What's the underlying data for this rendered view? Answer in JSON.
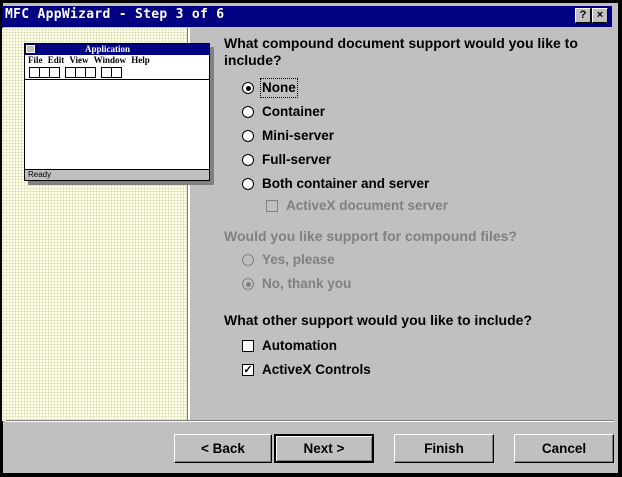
{
  "window": {
    "title": "MFC AppWizard - Step 3 of 6",
    "help_icon": "?",
    "close_icon": "×"
  },
  "preview": {
    "title": "Application",
    "menu": [
      "File",
      "Edit",
      "View",
      "Window",
      "Help"
    ],
    "status": "Ready"
  },
  "compound": {
    "question": "What compound document support would you like to include?",
    "options": [
      "None",
      "Container",
      "Mini-server",
      "Full-server",
      "Both container and server"
    ],
    "selected": "None",
    "activex_doc_server": "ActiveX document server"
  },
  "compound_files": {
    "question": "Would you like support for compound files?",
    "options": [
      "Yes, please",
      "No, thank you"
    ],
    "selected": "No, thank you"
  },
  "other": {
    "question": "What other support would you like to include?",
    "automation": "Automation",
    "activex_controls": "ActiveX Controls",
    "activex_controls_checked": "✓"
  },
  "buttons": {
    "back": "< Back",
    "next": "Next >",
    "finish": "Finish",
    "cancel": "Cancel"
  },
  "colors": {
    "titlebar": "#000080",
    "face": "#c0c0c0",
    "disabled_text": "#808080",
    "left_panel": "#ffffe8"
  }
}
